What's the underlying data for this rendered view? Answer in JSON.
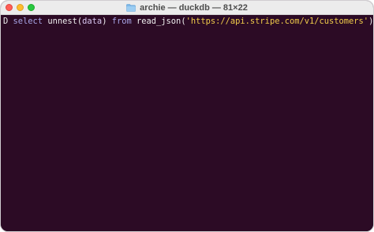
{
  "window": {
    "title": "archie — duckdb — 81×22",
    "title_icon": "folder-icon"
  },
  "traffic_lights": {
    "close": "#ff5f57",
    "minimize": "#febc2e",
    "zoom": "#28c840"
  },
  "colors": {
    "terminal_background": "#2c0b25",
    "keyword": "#a8a6e8",
    "string": "#f0cc4a"
  },
  "terminal": {
    "prompt": "D",
    "tokens": {
      "select": "select",
      "unnest": "unnest",
      "open_paren_1": "(",
      "data": "data",
      "close_paren_1": ")",
      "from": "from",
      "read_json": "read_json",
      "open_paren_2": "(",
      "url": "'https://api.stripe.com/v1/customers'",
      "close_paren_2": ")",
      "semicolon": ";"
    }
  }
}
